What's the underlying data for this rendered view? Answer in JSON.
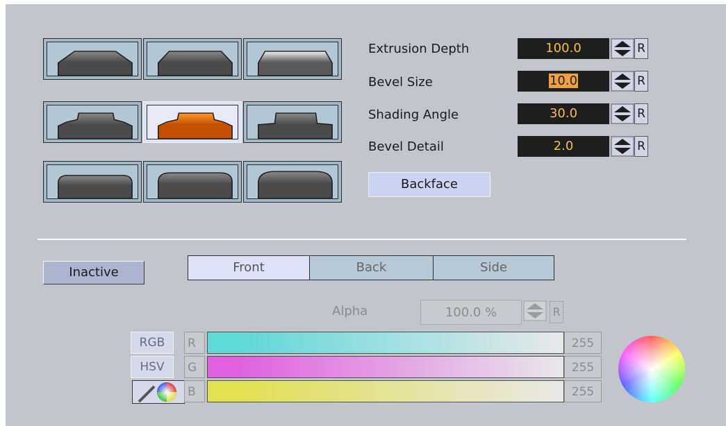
{
  "bevel_presets": [
    {
      "id": "chamfer-1",
      "selected": false
    },
    {
      "id": "chamfer-2",
      "selected": false
    },
    {
      "id": "chamfer-light",
      "selected": false
    },
    {
      "id": "step-1",
      "selected": false
    },
    {
      "id": "step-orange",
      "selected": true
    },
    {
      "id": "step-2",
      "selected": false
    },
    {
      "id": "round-1",
      "selected": false
    },
    {
      "id": "round-2",
      "selected": false
    },
    {
      "id": "round-3",
      "selected": false
    }
  ],
  "params": {
    "extrusion_depth": {
      "label": "Extrusion Depth",
      "value": "100.0"
    },
    "bevel_size": {
      "label": "Bevel Size",
      "value": "10.0"
    },
    "shading_angle": {
      "label": "Shading Angle",
      "value": "30.0"
    },
    "bevel_detail": {
      "label": "Bevel Detail",
      "value": "2.0"
    },
    "reset_label": "R"
  },
  "backface_label": "Backface",
  "inactive_label": "Inactive",
  "tabs": {
    "front": "Front",
    "back": "Back",
    "side": "Side",
    "active": "front"
  },
  "alpha": {
    "label": "Alpha",
    "value": "100.0 %",
    "reset_label": "R"
  },
  "color": {
    "modes": {
      "rgb": "RGB",
      "hsv": "HSV",
      "picker_icon": "color-picker-icon"
    },
    "channels": [
      {
        "name": "R",
        "value": "255",
        "color": "#5fd8d8"
      },
      {
        "name": "G",
        "value": "255",
        "color": "#e060e0"
      },
      {
        "name": "B",
        "value": "255",
        "color": "#e0e050"
      }
    ]
  },
  "colors": {
    "panel": "#c3c5cc",
    "value_bg": "#1e1e1e",
    "value_text": "#f2c14a",
    "selected_bevel": "#cc5a00"
  }
}
